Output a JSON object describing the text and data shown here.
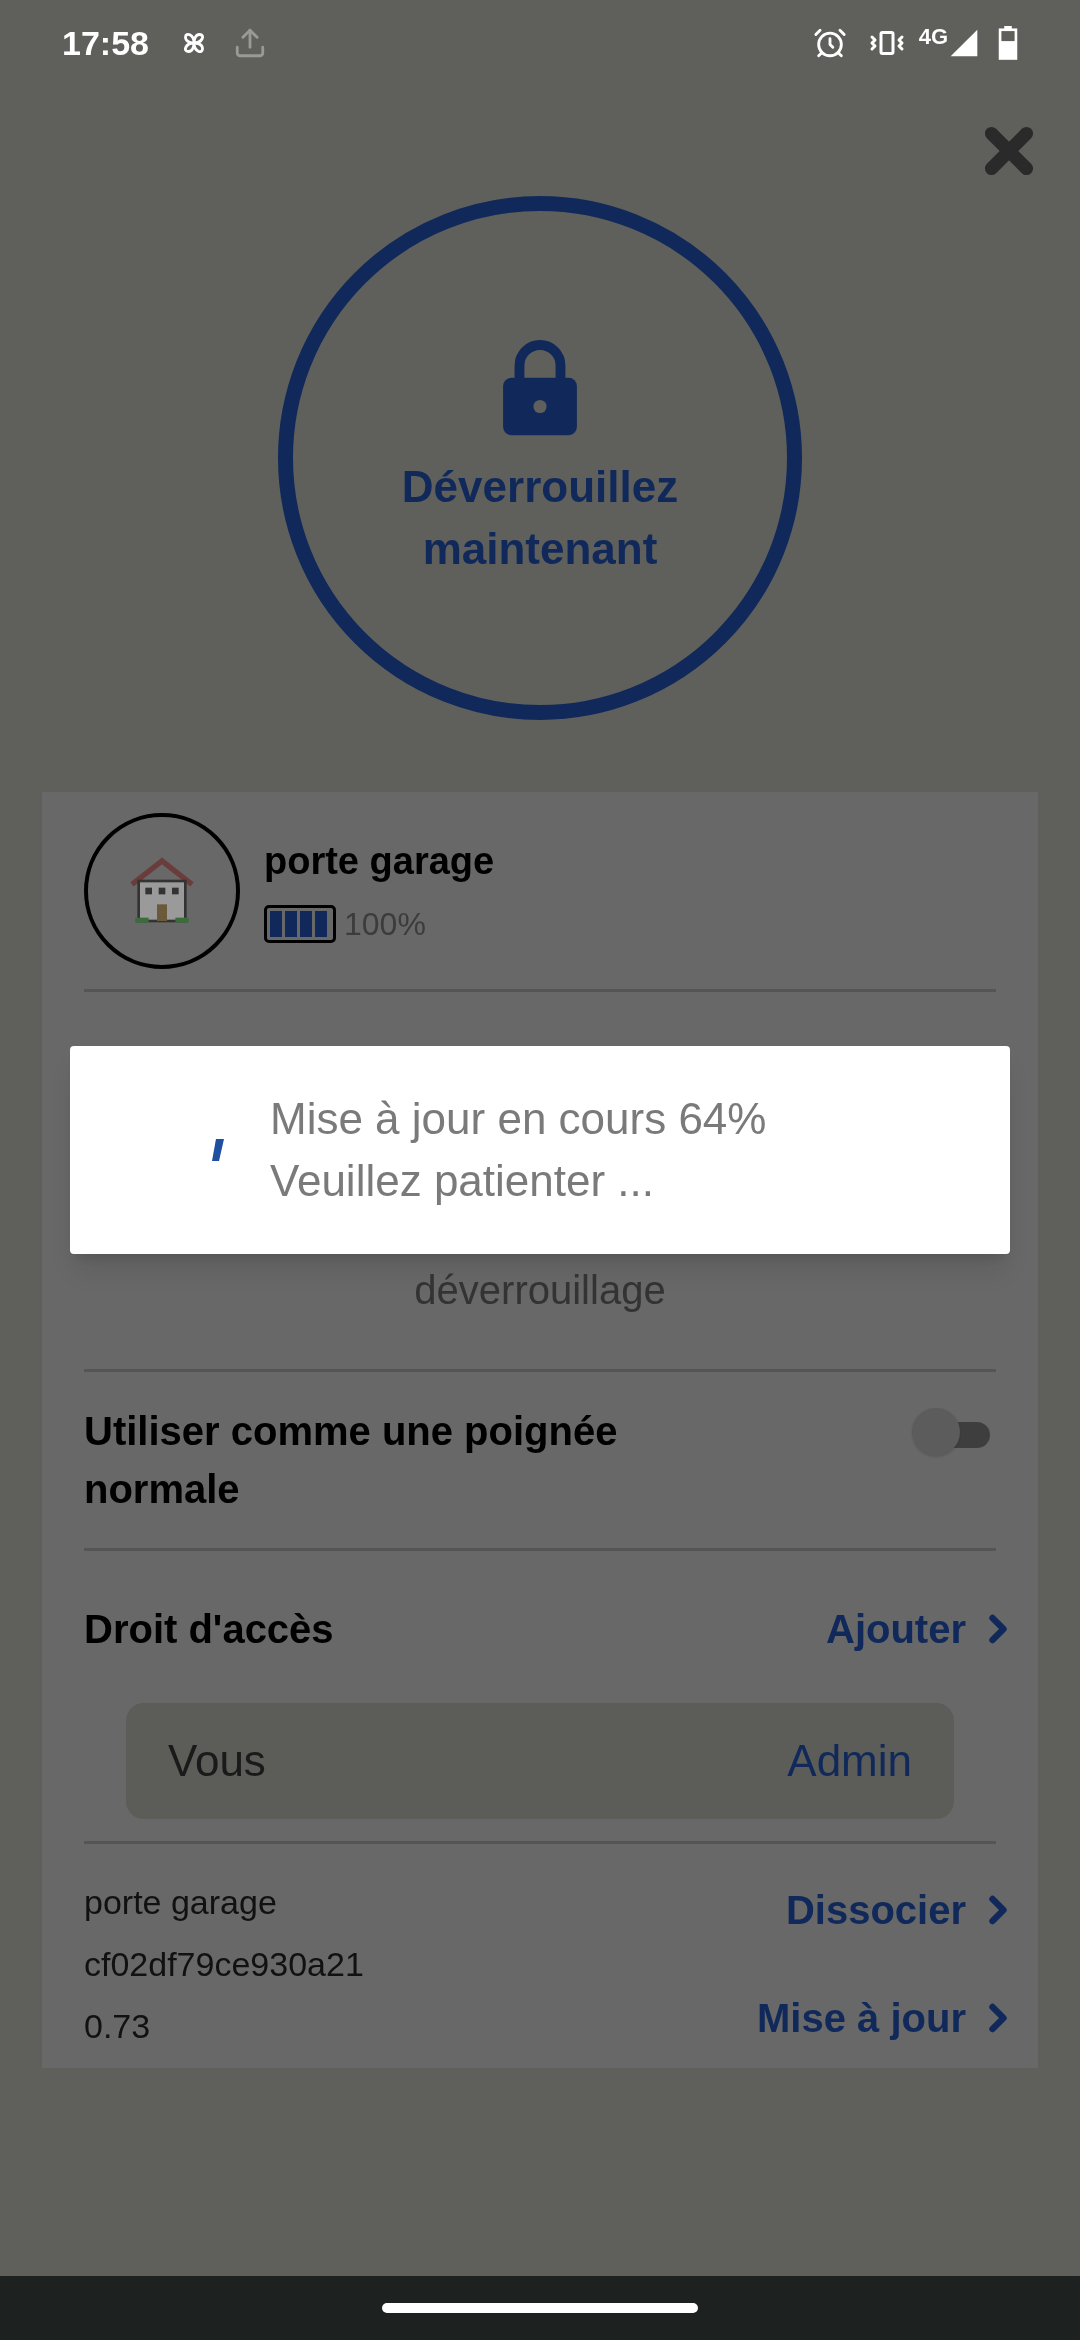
{
  "status_bar": {
    "time": "17:58",
    "network": "4G"
  },
  "unlock_button": {
    "label": "Déverrouillez maintenant"
  },
  "device": {
    "name": "porte garage",
    "battery": {
      "level": 1,
      "reading": "100%"
    }
  },
  "dialog": {
    "lines": [
      "Mise à jour en cours 64%",
      "Veuillez patienter ..."
    ]
  },
  "behind_dialog_text": "déverrouillage",
  "setting": {
    "label": "Utiliser comme une poignée normale",
    "on": false
  },
  "access": {
    "title": "Droit d'accès",
    "add_label": "Ajouter",
    "users": [
      {
        "name": "Vous",
        "role": "Admin"
      }
    ]
  },
  "info": {
    "lines": [
      "porte garage",
      "cf02df79ce930a21",
      "0.73"
    ],
    "actions": [
      {
        "label": "Dissocier"
      },
      {
        "label": "Mise à jour"
      }
    ]
  }
}
